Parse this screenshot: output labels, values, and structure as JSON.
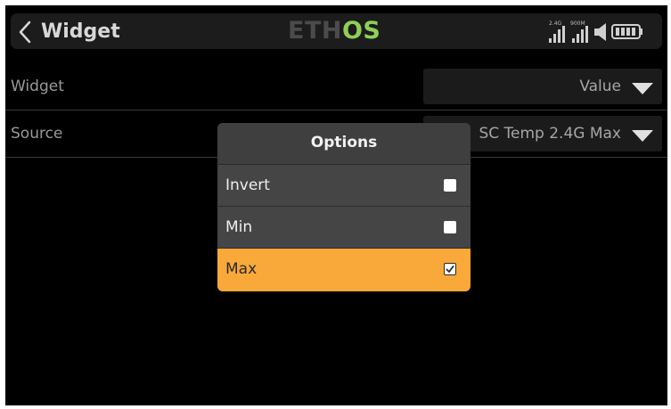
{
  "header": {
    "back_icon": "chevron-left-icon",
    "title": "Widget",
    "logo_text_a": "ETH",
    "logo_text_b": "OS",
    "logo_accent_color": "#8fcf57",
    "status": {
      "rf_2_4g_label": "2.4G",
      "rf_900m_label": "900M",
      "icons": [
        "signal-2-4g-icon",
        "signal-900m-icon",
        "speaker-icon",
        "battery-icon"
      ]
    }
  },
  "rows": [
    {
      "label": "Widget",
      "value": "Value"
    },
    {
      "label": "Source",
      "value": "SC Temp 2.4G Max"
    }
  ],
  "dialog": {
    "title": "Options",
    "options": [
      {
        "label": "Invert",
        "checked": false
      },
      {
        "label": "Min",
        "checked": false
      },
      {
        "label": "Max",
        "checked": true
      }
    ],
    "selected_color": "#f8a93a"
  }
}
